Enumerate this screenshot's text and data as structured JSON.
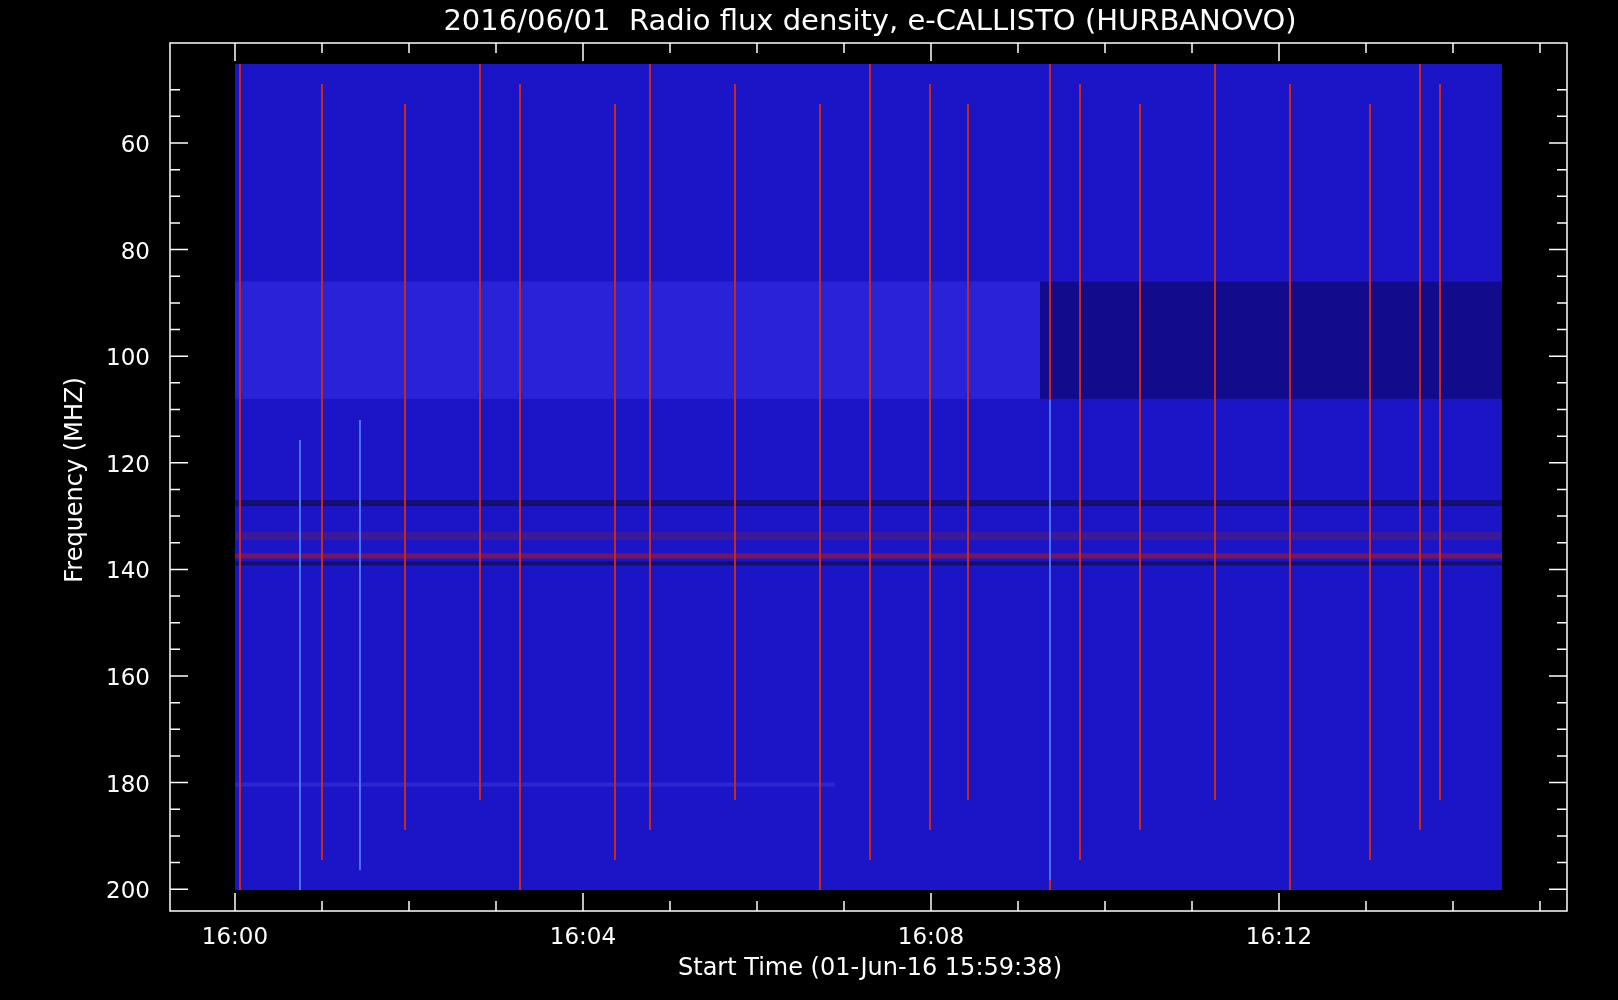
{
  "title": "2016/06/01  Radio flux density, e-CALLISTO (HURBANOVO)",
  "y_axis": {
    "label": "Frequency (MHZ)",
    "ticks": [
      "60",
      "80",
      "100",
      "120",
      "140",
      "160",
      "180",
      "200"
    ]
  },
  "x_axis": {
    "label": "Start Time (01-Jun-16 15:59:38)",
    "ticks": [
      "16:00",
      "16:04",
      "16:08",
      "16:12"
    ]
  }
}
